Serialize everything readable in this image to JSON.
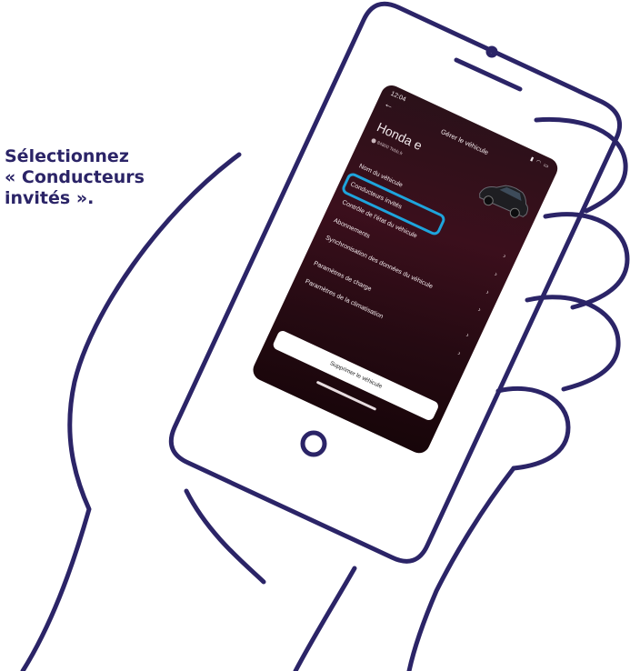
{
  "instruction": {
    "line1": "Sélectionnez",
    "line2": "« Conducteurs",
    "line3": "invités »."
  },
  "status_bar": {
    "time": "12:04",
    "icons": "signal-icon wifi-icon battery-icon"
  },
  "header": {
    "back_icon": "arrow-left-icon",
    "title": "Gérer le véhicule"
  },
  "vehicle": {
    "name": "Honda e",
    "location": "84800 Tebb.fr"
  },
  "menu": {
    "items": [
      {
        "label": "Nom du véhicule",
        "highlighted": false
      },
      {
        "label": "Conducteurs invités",
        "highlighted": true
      },
      {
        "label": "Contrôle de l'état du véhicule",
        "highlighted": false
      },
      {
        "label": "Abonnements",
        "highlighted": false
      },
      {
        "label": "Synchronisation des données du véhicule",
        "highlighted": false
      },
      {
        "label": "Paramètres de charge",
        "highlighted": false
      },
      {
        "label": "Paramètres de la climatisation",
        "highlighted": false
      }
    ]
  },
  "delete_button": "Supprimer le véhicule",
  "colors": {
    "outline": "#2b2467",
    "highlight": "#1ea4dc",
    "screen_bg": "#2a0d16"
  }
}
